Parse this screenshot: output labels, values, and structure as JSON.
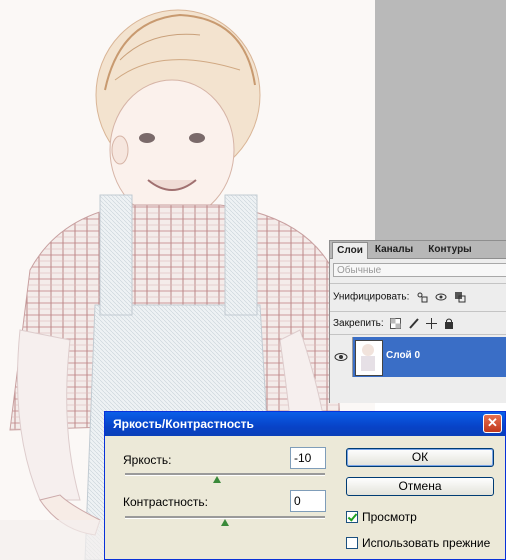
{
  "layers_panel": {
    "tabs": [
      {
        "label": "Слои"
      },
      {
        "label": "Каналы"
      },
      {
        "label": "Контуры"
      }
    ],
    "blend_mode": "Обычные",
    "unify_label": "Унифицировать:",
    "lock_label": "Закрепить:",
    "layer": {
      "name": "Слой 0"
    }
  },
  "dialog": {
    "title": "Яркость/Контрастность",
    "brightness": {
      "label": "Яркость:",
      "value": "-10"
    },
    "contrast": {
      "label": "Контрастность:",
      "value": "0"
    },
    "ok_label": "ОК",
    "cancel_label": "Отмена",
    "preview_label": "Просмотр",
    "preview_checked": true,
    "legacy_label": "Использовать прежние",
    "legacy_checked": false
  },
  "colors": {
    "titlebar": "#0a5fe8",
    "selected_layer": "#3a6ec6",
    "dialog_bg": "#ece9d8"
  }
}
